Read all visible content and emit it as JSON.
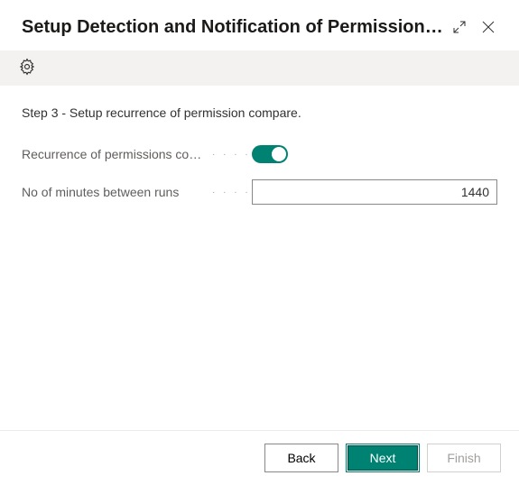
{
  "header": {
    "title": "Setup Detection and Notification of Permission …"
  },
  "step": {
    "title": "Step 3 - Setup recurrence of permission compare."
  },
  "form": {
    "recurrence": {
      "label": "Recurrence of permissions com…",
      "enabled": true
    },
    "minutes": {
      "label": "No of minutes between runs",
      "value": "1440"
    }
  },
  "footer": {
    "back": "Back",
    "next": "Next",
    "finish": "Finish"
  }
}
